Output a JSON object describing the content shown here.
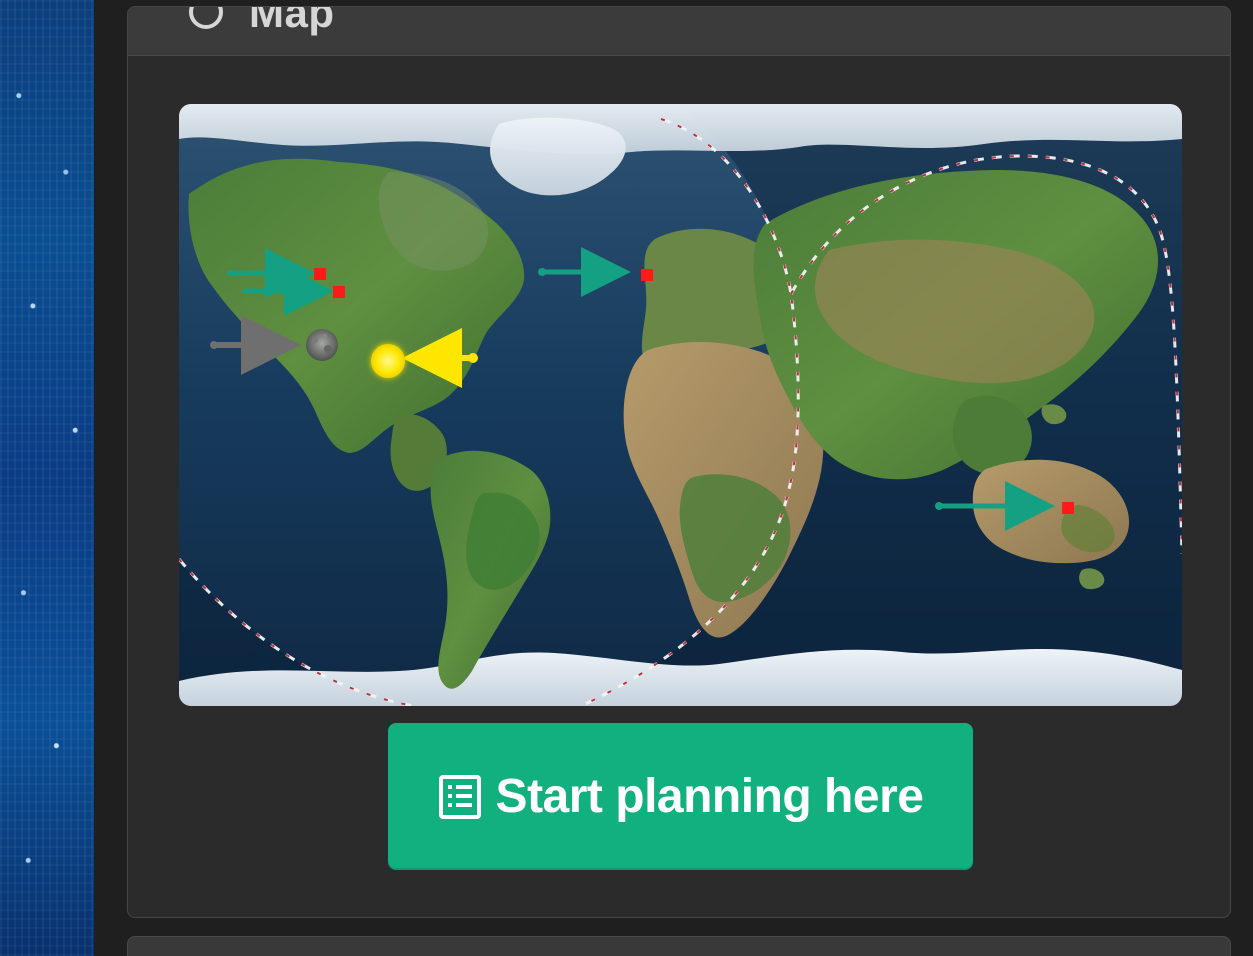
{
  "page": {
    "background": "#1f1f1f"
  },
  "map_panel": {
    "title": "Map",
    "title_icon": "globe-icon",
    "accent_colors": {
      "panel": "#2b2b2b",
      "header": "#3b3b3b",
      "button": "#13b07f",
      "marker": "#ff1a1a",
      "arrow_primary": "#14a082",
      "arrow_secondary": "#6f6f6f",
      "sun_arrow": "#ffe600"
    }
  },
  "map": {
    "markers": [
      {
        "name": "west-coast-marker-top",
        "color": "#ff1a1a",
        "icon": "location-square-icon"
      },
      {
        "name": "west-coast-marker-bottom",
        "color": "#ff1a1a",
        "icon": "location-square-icon"
      },
      {
        "name": "western-europe-marker",
        "color": "#ff1a1a",
        "icon": "location-square-icon"
      },
      {
        "name": "australia-marker",
        "color": "#ff1a1a",
        "icon": "location-square-icon"
      }
    ],
    "overlays": {
      "moon_icon": "moon-icon",
      "sun_icon": "sun-icon",
      "terminator": "day-night-boundary"
    }
  },
  "cta": {
    "label": "Start planning here",
    "icon": "list-icon"
  }
}
